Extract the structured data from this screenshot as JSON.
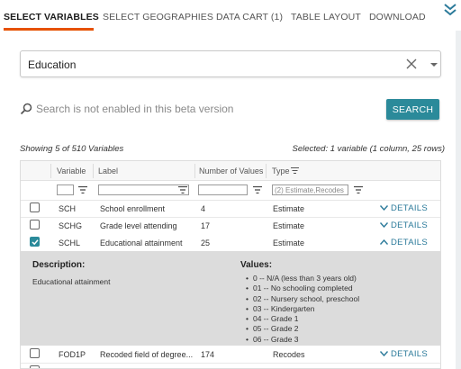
{
  "tabs": [
    {
      "label": "SELECT VARIABLES",
      "active": true
    },
    {
      "label": "SELECT GEOGRAPHIES",
      "active": false
    },
    {
      "label": "DATA CART (1)",
      "active": false
    },
    {
      "label": "TABLE LAYOUT",
      "active": false
    },
    {
      "label": "DOWNLOAD",
      "active": false
    }
  ],
  "topic_select": {
    "value": "Education"
  },
  "search": {
    "placeholder": "Search is not enabled in this beta version",
    "button_label": "SEARCH"
  },
  "summary": {
    "showing": "Showing 5 of 510 Variables",
    "selected": "Selected: 1 variable (1 column, 25 rows)"
  },
  "table": {
    "columns": {
      "variable": "Variable",
      "label": "Label",
      "num_values": "Number of Values",
      "type": "Type"
    },
    "filter": {
      "type_placeholder": "(2) Estimate,Recodes"
    },
    "rows": [
      {
        "variable": "SCH",
        "label": "School enrollment",
        "num_values": "4",
        "type": "Estimate",
        "action": "DETAILS",
        "checked": false,
        "expanded": false
      },
      {
        "variable": "SCHG",
        "label": "Grade level attending",
        "num_values": "17",
        "type": "Estimate",
        "action": "DETAILS",
        "checked": false,
        "expanded": false
      },
      {
        "variable": "SCHL",
        "label": "Educational attainment",
        "num_values": "25",
        "type": "Estimate",
        "action": "DETAILS",
        "checked": true,
        "expanded": true
      },
      {
        "variable": "FOD1P",
        "label": "Recoded field of degree...",
        "num_values": "174",
        "type": "Recodes",
        "action": "DETAILS",
        "checked": false,
        "expanded": false
      }
    ],
    "detail": {
      "description_heading": "Description:",
      "description_text": "Educational attainment",
      "values_heading": "Values:",
      "values": [
        "0 -- N/A (less than 3 years old)",
        "01 -- No schooling completed",
        "02 -- Nursery school, preschool",
        "03 -- Kindergarten",
        "04 -- Grade 1",
        "05 -- Grade 2",
        "06 -- Grade 3"
      ]
    }
  },
  "colors": {
    "accent": "#e65100",
    "teal": "#2b8a9a",
    "link": "#2b7a9a"
  },
  "icons": [
    "double-chevron-down-icon",
    "clear-icon",
    "dropdown-caret-icon",
    "search-icon",
    "filter-icon",
    "checkbox-icon",
    "chevron-down-icon",
    "chevron-up-icon"
  ]
}
